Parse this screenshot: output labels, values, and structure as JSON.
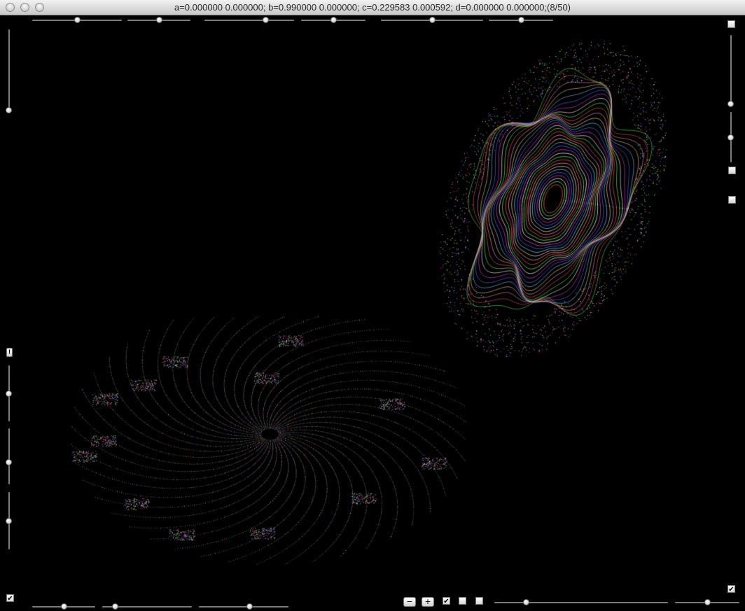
{
  "window": {
    "title": "a=0.000000 0.000000; b=0.990000 0.000000; c=0.229583 0.000592; d=0.000000 0.000000;(8/50)"
  },
  "top_sliders": [
    {
      "value": 0.5
    },
    {
      "value": 0.5
    },
    {
      "value": 0.68
    },
    {
      "value": 0.5
    },
    {
      "value": 0.5
    },
    {
      "value": 0.5
    }
  ],
  "left_sliders": [
    {
      "value": 0.96
    },
    {
      "value": 0.5
    },
    {
      "value": 0.6
    },
    {
      "value": 0.5
    }
  ],
  "right_sliders": [
    {
      "value": 0.96
    },
    {
      "value": 0.5
    }
  ],
  "bottom_sliders": [
    {
      "value": 0.5
    },
    {
      "value": 0.14
    },
    {
      "value": 0.56
    },
    {
      "value": 0.18
    },
    {
      "value": 0.5
    }
  ],
  "checkboxes": {
    "top_right": false,
    "right_1": false,
    "right_2": false,
    "bottom_left": true,
    "bottom_right": true,
    "bottom_center_1": true,
    "bottom_center_2": false,
    "bottom_center_3": false
  },
  "buttons": {
    "minus_label": "−",
    "plus_label": "+",
    "left_button_label": "!"
  },
  "colors": {
    "background": "#000000",
    "orbit_palette": [
      "#ff5a5a",
      "#5aff5a",
      "#ffffff",
      "#e040e0",
      "#5a6aff",
      "#6ad0ff",
      "#ffe07a",
      "#ff9ad0"
    ]
  }
}
